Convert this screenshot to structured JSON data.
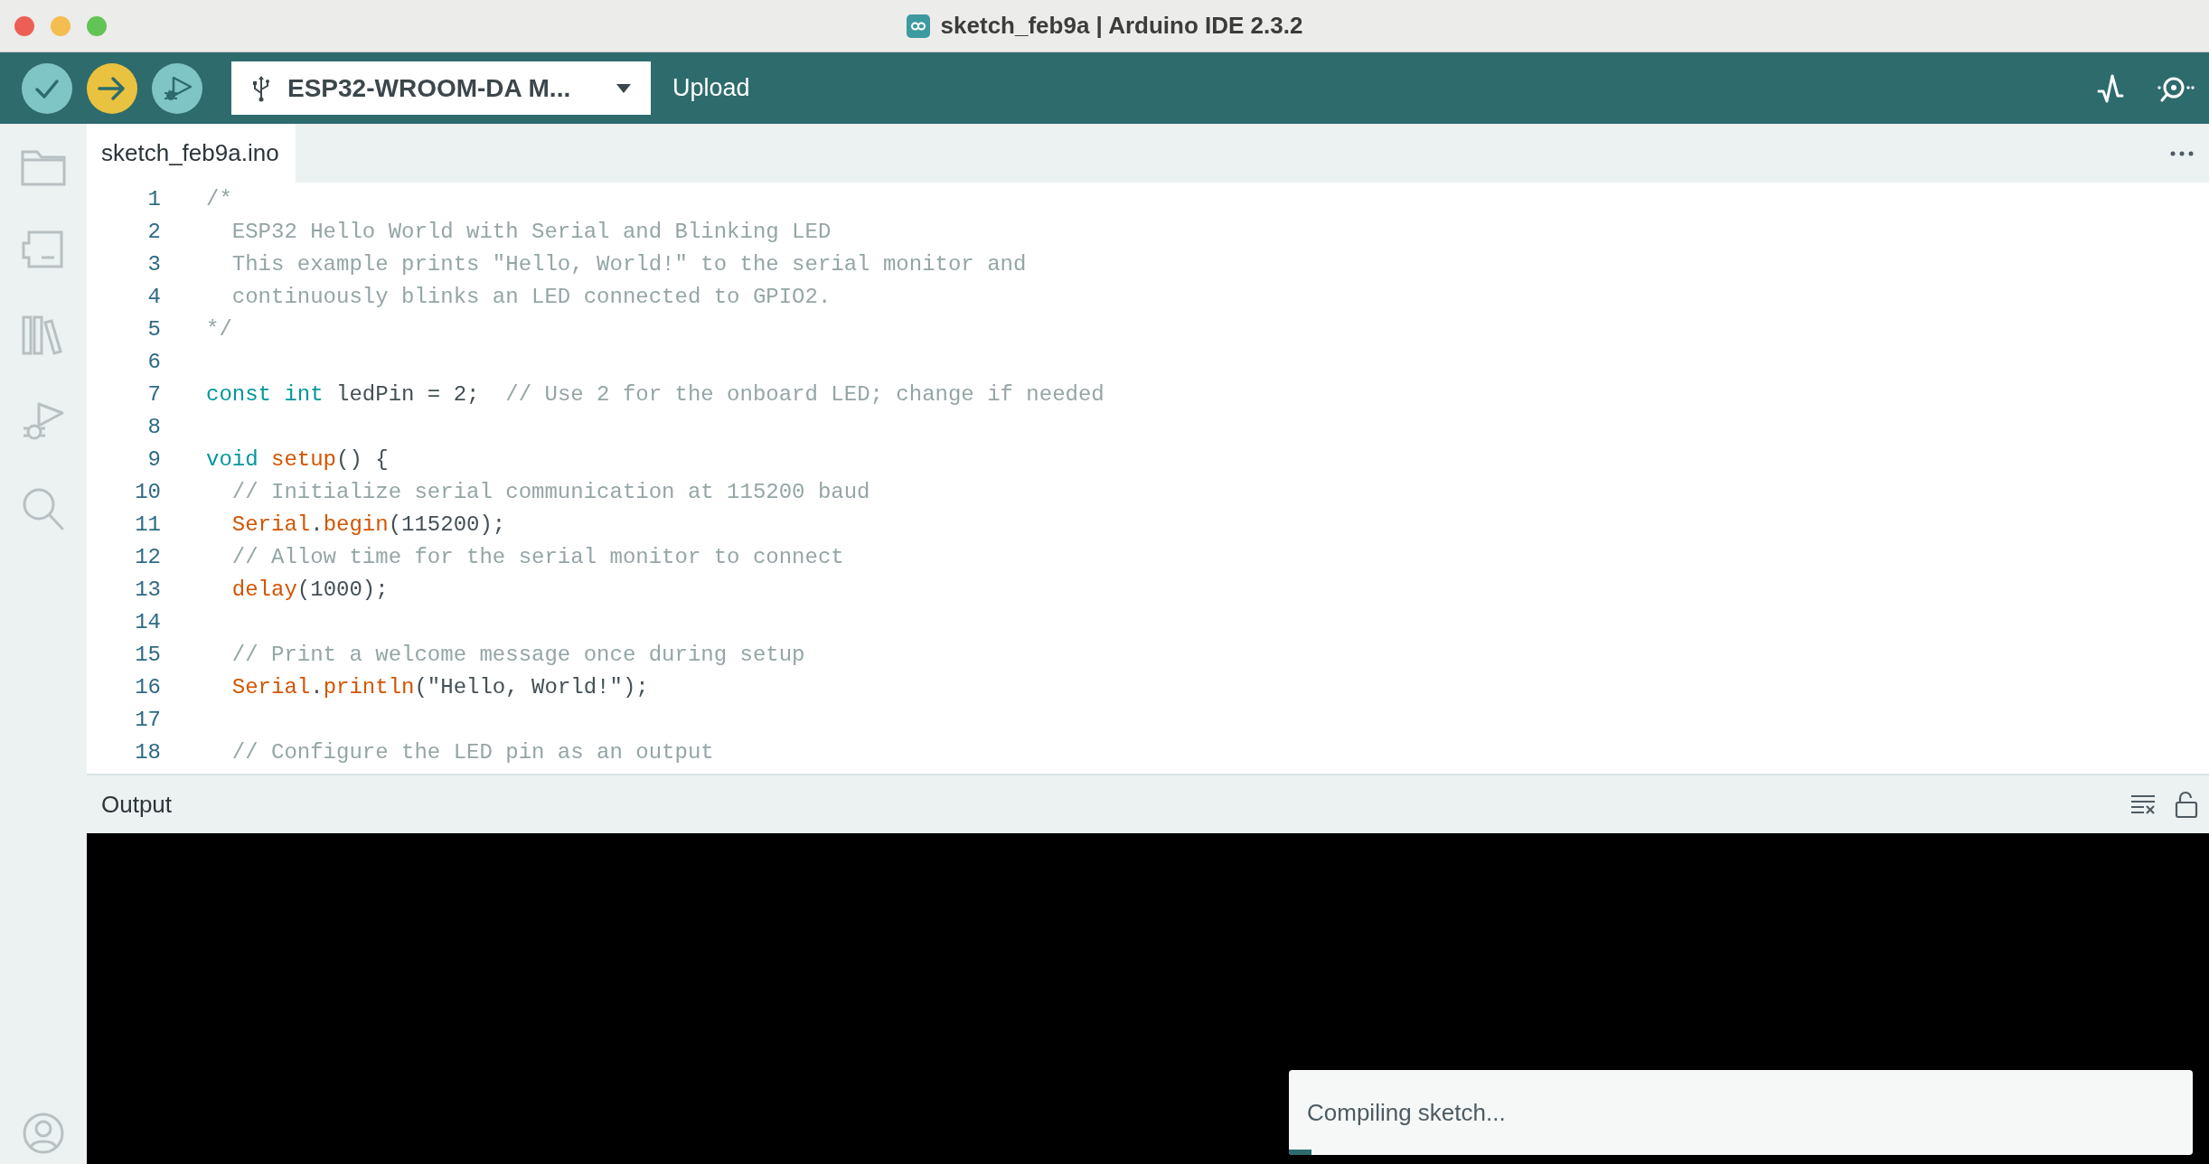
{
  "window": {
    "title": "sketch_feb9a | Arduino IDE 2.3.2"
  },
  "toolbar": {
    "board": "ESP32-WROOM-DA M...",
    "hover_label": "Upload"
  },
  "editor": {
    "tabs": [
      {
        "label": "sketch_feb9a.ino",
        "selected": true
      }
    ],
    "lines": [
      {
        "number": "1",
        "tokens": [
          {
            "kind": "comment",
            "text": "/*"
          }
        ]
      },
      {
        "number": "2",
        "tokens": [
          {
            "kind": "comment",
            "text": "  ESP32 Hello World with Serial and Blinking LED"
          }
        ]
      },
      {
        "number": "3",
        "tokens": [
          {
            "kind": "comment",
            "text": "  This example prints \"Hello, World!\" to the serial monitor and"
          }
        ]
      },
      {
        "number": "4",
        "tokens": [
          {
            "kind": "comment",
            "text": "  continuously blinks an LED connected to GPIO2."
          }
        ]
      },
      {
        "number": "5",
        "tokens": [
          {
            "kind": "comment",
            "text": "*/"
          }
        ]
      },
      {
        "number": "6"
      },
      {
        "number": "7",
        "tokens": [
          {
            "kind": "keyword",
            "text": "const int"
          },
          {
            "kind": "plain",
            "text": " ledPin = 2;  "
          },
          {
            "kind": "comment",
            "text": "// Use 2 for the onboard LED; change if needed"
          }
        ]
      },
      {
        "number": "8"
      },
      {
        "number": "9",
        "tokens": [
          {
            "kind": "keyword",
            "text": "void"
          },
          {
            "kind": "function",
            "text": " setup"
          },
          {
            "kind": "plain",
            "text": "() {"
          }
        ]
      },
      {
        "number": "10",
        "tokens": [
          {
            "kind": "comment",
            "text": "  // Initialize serial communication at 115200 baud"
          }
        ]
      },
      {
        "number": "11",
        "tokens": [
          {
            "kind": "function",
            "text": "  Serial"
          },
          {
            "kind": "plain",
            "text": "."
          },
          {
            "kind": "function",
            "text": "begin"
          },
          {
            "kind": "plain",
            "text": "(115200);"
          }
        ]
      },
      {
        "number": "12",
        "tokens": [
          {
            "kind": "comment",
            "text": "  // Allow time for the serial monitor to connect"
          }
        ]
      },
      {
        "number": "13",
        "tokens": [
          {
            "kind": "function",
            "text": "  delay"
          },
          {
            "kind": "plain",
            "text": "(1000);"
          }
        ]
      },
      {
        "number": "14"
      },
      {
        "number": "15",
        "tokens": [
          {
            "kind": "comment",
            "text": "  // Print a welcome message once during setup"
          }
        ]
      },
      {
        "number": "16",
        "tokens": [
          {
            "kind": "function",
            "text": "  Serial"
          },
          {
            "kind": "plain",
            "text": "."
          },
          {
            "kind": "function",
            "text": "println"
          },
          {
            "kind": "plain",
            "text": "(\"Hello, World!\");"
          }
        ]
      },
      {
        "number": "17"
      },
      {
        "number": "18",
        "tokens": [
          {
            "kind": "comment",
            "text": "  // Configure the LED pin as an output"
          }
        ]
      }
    ]
  },
  "output": {
    "title": "Output"
  },
  "notification": {
    "message": "Compiling sketch...",
    "level": 0.025
  }
}
